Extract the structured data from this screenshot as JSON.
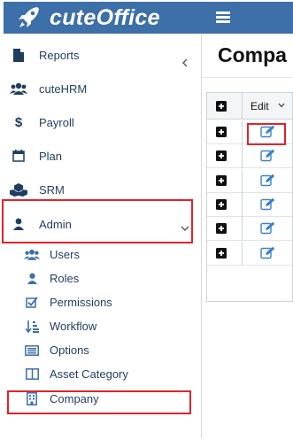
{
  "app": {
    "name": "cuteOffice"
  },
  "sidebar": {
    "items": [
      {
        "label": "Reports",
        "icon": "file-icon"
      },
      {
        "label": "cuteHRM",
        "icon": "users-icon"
      },
      {
        "label": "Payroll",
        "icon": "dollar-icon"
      },
      {
        "label": "Plan",
        "icon": "calendar-icon"
      },
      {
        "label": "SRM",
        "icon": "cubes-icon"
      },
      {
        "label": "Admin",
        "icon": "user-icon"
      }
    ],
    "admin_sub": [
      {
        "label": "Users",
        "icon": "users-icon"
      },
      {
        "label": "Roles",
        "icon": "user-icon"
      },
      {
        "label": "Permissions",
        "icon": "checkbox-icon"
      },
      {
        "label": "Workflow",
        "icon": "sort-list-icon"
      },
      {
        "label": "Options",
        "icon": "list-box-icon"
      },
      {
        "label": "Asset Category",
        "icon": "columns-icon"
      },
      {
        "label": "Company",
        "icon": "building-icon"
      }
    ]
  },
  "main": {
    "title": "Compa",
    "grid": {
      "header_edit": "Edit",
      "row_count": 6
    }
  },
  "colors": {
    "brand": "#3d6fa8",
    "nav_text": "#1f3d5f",
    "highlight": "#e0232a",
    "edit_icon": "#3b82c4"
  }
}
